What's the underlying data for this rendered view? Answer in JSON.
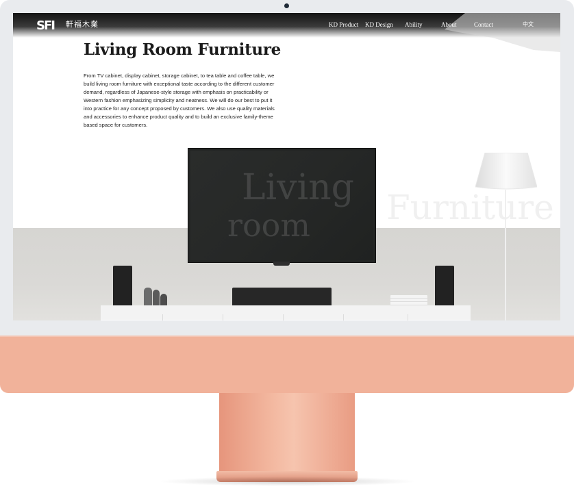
{
  "logo": {
    "mark": "SFI",
    "chinese_name": "軒福木業",
    "tagline": ""
  },
  "nav": {
    "items": [
      {
        "label": "KD Product"
      },
      {
        "label": "KD Design"
      },
      {
        "label": "Ability"
      },
      {
        "label": "About"
      },
      {
        "label": "Contact"
      }
    ],
    "language": "中文"
  },
  "page": {
    "title": "Living Room Furniture",
    "description": "From TV cabinet, display cabinet, storage cabinet, to tea table and coffee table, we build living room furniture with exceptional taste according to the different customer demand, regardless of Japanese-style storage with emphasis on practicability or Western fashion emphasizing simplicity and neatness. We will do our best to put it into practice for any concept proposed by customers. We also use quality materials and accessories to enhance product quality and to build an exclusive family-theme based space for customers."
  },
  "hero": {
    "watermark_line1": "Living",
    "watermark_line2": "room",
    "watermark_line3": "Furniture"
  },
  "colors": {
    "chin": "#f1b29a",
    "bezel": "#e9ebee",
    "title_text": "#1a1a1a",
    "nav_text": "#ffffff"
  }
}
